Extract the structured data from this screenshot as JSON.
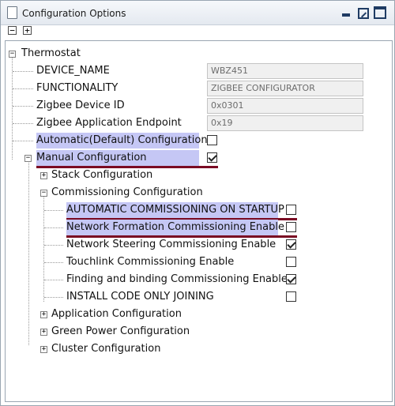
{
  "window": {
    "title": "Configuration Options"
  },
  "toolbar": {
    "collapse_all": "−",
    "expand_all": "+"
  },
  "tree": {
    "root": {
      "label": "Thermostat",
      "expander": "−"
    },
    "device_name": {
      "label": "DEVICE_NAME",
      "value": "WBZ451"
    },
    "functionality": {
      "label": "FUNCTIONALITY",
      "value": "ZIGBEE CONFIGURATOR"
    },
    "device_id": {
      "label": "Zigbee Device ID",
      "value": "0x0301"
    },
    "app_endpoint": {
      "label": "Zigbee Application Endpoint",
      "value": "0x19"
    },
    "auto_config": {
      "label": "Automatic(Default) Configuration",
      "checked": false
    },
    "manual_config": {
      "label": "Manual Configuration",
      "expander": "−",
      "checked": true
    },
    "stack_config": {
      "label": "Stack Configuration",
      "expander": "+"
    },
    "commissioning_config": {
      "label": "Commissioning Configuration",
      "expander": "−"
    },
    "auto_commissioning": {
      "label": "AUTOMATIC COMMISSIONING ON STARTUP",
      "checked": false
    },
    "network_formation": {
      "label": "Network Formation Commissioning Enable",
      "checked": false
    },
    "network_steering": {
      "label": "Network Steering Commissioning Enable",
      "checked": true
    },
    "touchlink": {
      "label": "Touchlink Commissioning Enable",
      "checked": false
    },
    "finding_binding": {
      "label": "Finding and binding Commissioning Enable",
      "checked": true
    },
    "install_code": {
      "label": "INSTALL CODE ONLY JOINING",
      "checked": false
    },
    "app_config": {
      "label": "Application Configuration",
      "expander": "+"
    },
    "green_power": {
      "label": "Green Power Configuration",
      "expander": "+"
    },
    "cluster_config": {
      "label": "Cluster Configuration",
      "expander": "+"
    }
  },
  "colors": {
    "highlight": "#c5c7f5",
    "underline": "#7a0b23"
  }
}
